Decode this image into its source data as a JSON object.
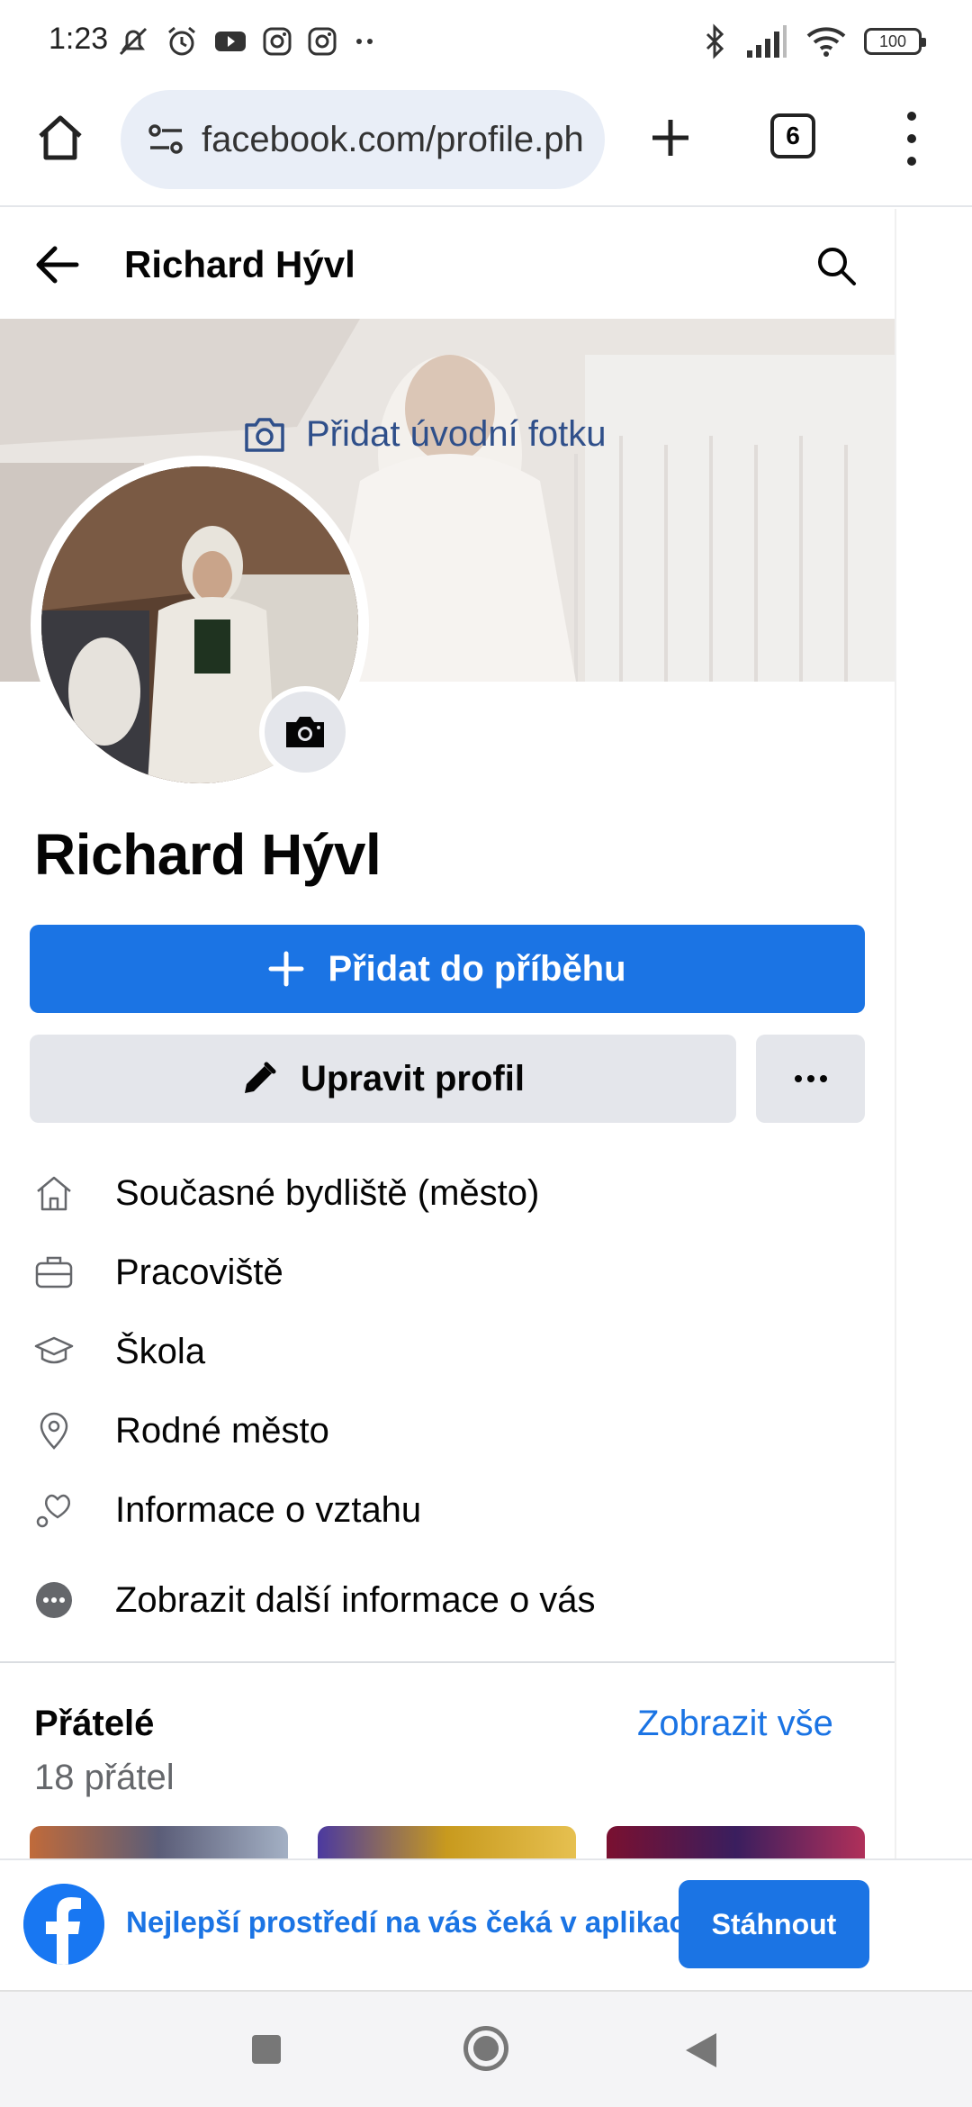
{
  "status_bar": {
    "time": "1:23",
    "battery": "100",
    "icons_left": [
      "mute-alarm-icon",
      "alarm-icon",
      "youtube-icon",
      "instagram-icon",
      "instagram-icon",
      "more-dots-icon"
    ],
    "icons_right": [
      "bluetooth-icon",
      "signal-icon",
      "wifi-icon",
      "battery-icon"
    ]
  },
  "browser": {
    "url": "facebook.com/profile.ph",
    "tab_count": "6"
  },
  "header": {
    "title": "Richard Hývl"
  },
  "cover": {
    "add_label": "Přidat úvodní fotku"
  },
  "profile": {
    "name": "Richard Hývl",
    "story_button": "Přidat do příběhu",
    "edit_button": "Upravit profil"
  },
  "info": [
    {
      "label": "Současné bydliště (město)",
      "icon": "home-icon"
    },
    {
      "label": "Pracoviště",
      "icon": "briefcase-icon"
    },
    {
      "label": "Škola",
      "icon": "graduation-cap-icon"
    },
    {
      "label": "Rodné město",
      "icon": "location-pin-icon"
    },
    {
      "label": "Informace o vztahu",
      "icon": "heart-icon"
    },
    {
      "label": "Zobrazit další informace o vás",
      "icon": "more-circle-icon"
    }
  ],
  "friends": {
    "title": "Přátelé",
    "link": "Zobrazit vše",
    "count": "18 přátel"
  },
  "banner": {
    "text": "Nejlepší prostředí na vás čeká v aplikaci",
    "button": "Stáhnout"
  },
  "colors": {
    "accent": "#1b74e4",
    "secondary_button": "#e4e6eb",
    "text": "#050505",
    "muted_text": "#65676b"
  }
}
